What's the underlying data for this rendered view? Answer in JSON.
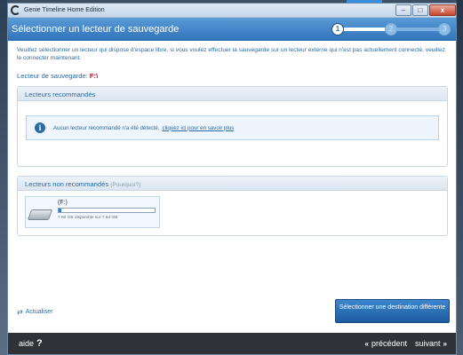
{
  "window": {
    "title": "Genie Timeline Home Edition",
    "controls": {
      "minimize": "‒",
      "maximize": "□",
      "close": "x"
    }
  },
  "header": {
    "title": "Sélectionner un lecteur de sauvegarde",
    "steps": [
      "1",
      "2",
      "3"
    ],
    "current_step": 1
  },
  "intro": "Veuillez sélectionner un lecteur qui dispose d'espace libre, si vous voulez effectuer la sauvegarde sur un lecteur externe qui n'est pas actuellement connecté, veuillez le connecter maintenant.",
  "backup_drive": {
    "label": "Lecteur de sauvegarde:",
    "value": "F:\\"
  },
  "recommended": {
    "title": "Lecteurs recommandés",
    "info_text": "Aucun lecteur recommandé n'a été détecté,",
    "info_link": "cliquez ici pour en savoir plus"
  },
  "not_recommended": {
    "title": "Lecteurs non recommandés",
    "why": "(Pourquoi?)",
    "drives": [
      {
        "name": "(F:)",
        "space": "7.60 GB disponible sur 7.84 GB",
        "used_fraction": 0.03
      }
    ]
  },
  "actions": {
    "refresh": "Actualiser",
    "select_destination": "Sélectionner une destination différente"
  },
  "bottom": {
    "help": "aide",
    "help_symbol": "?",
    "previous": "précédent",
    "next": "suivant",
    "prev_arrow": "«",
    "next_arrow": "»"
  },
  "colors": {
    "accent": "#2f72b8",
    "link_text": "#2b6aa3",
    "drive_letter": "#d0021b",
    "bottom_bar": "#2f3338"
  }
}
